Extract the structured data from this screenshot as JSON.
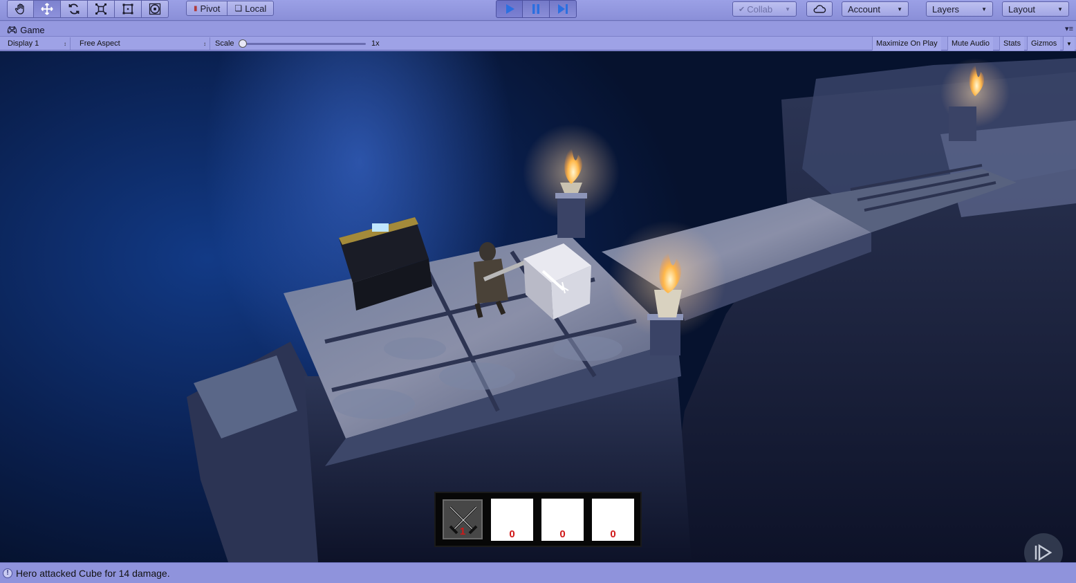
{
  "toolbar": {
    "transform_tools": [
      "hand-tool",
      "move-tool",
      "rotate-tool",
      "scale-tool",
      "rect-tool",
      "transform-tool"
    ],
    "pivot_label": "Pivot",
    "local_label": "Local",
    "collab_label": "Collab",
    "account_label": "Account",
    "layers_label": "Layers",
    "layout_label": "Layout"
  },
  "tab": {
    "title": "Game"
  },
  "gamebar": {
    "display": "Display 1",
    "aspect": "Free Aspect",
    "scale_label": "Scale",
    "scale_value": "1x",
    "maximize_on_play": "Maximize On Play",
    "mute_audio": "Mute Audio",
    "stats": "Stats",
    "gizmos": "Gizmos"
  },
  "hud": {
    "weapon_count": "1",
    "slots": [
      "0",
      "0",
      "0"
    ]
  },
  "status": {
    "message": "Hero attacked Cube for 14 damage."
  },
  "colors": {
    "editor_chrome": "#8b8fd6",
    "play_active": "#2b6fe0",
    "hud_count": "#d01818"
  }
}
